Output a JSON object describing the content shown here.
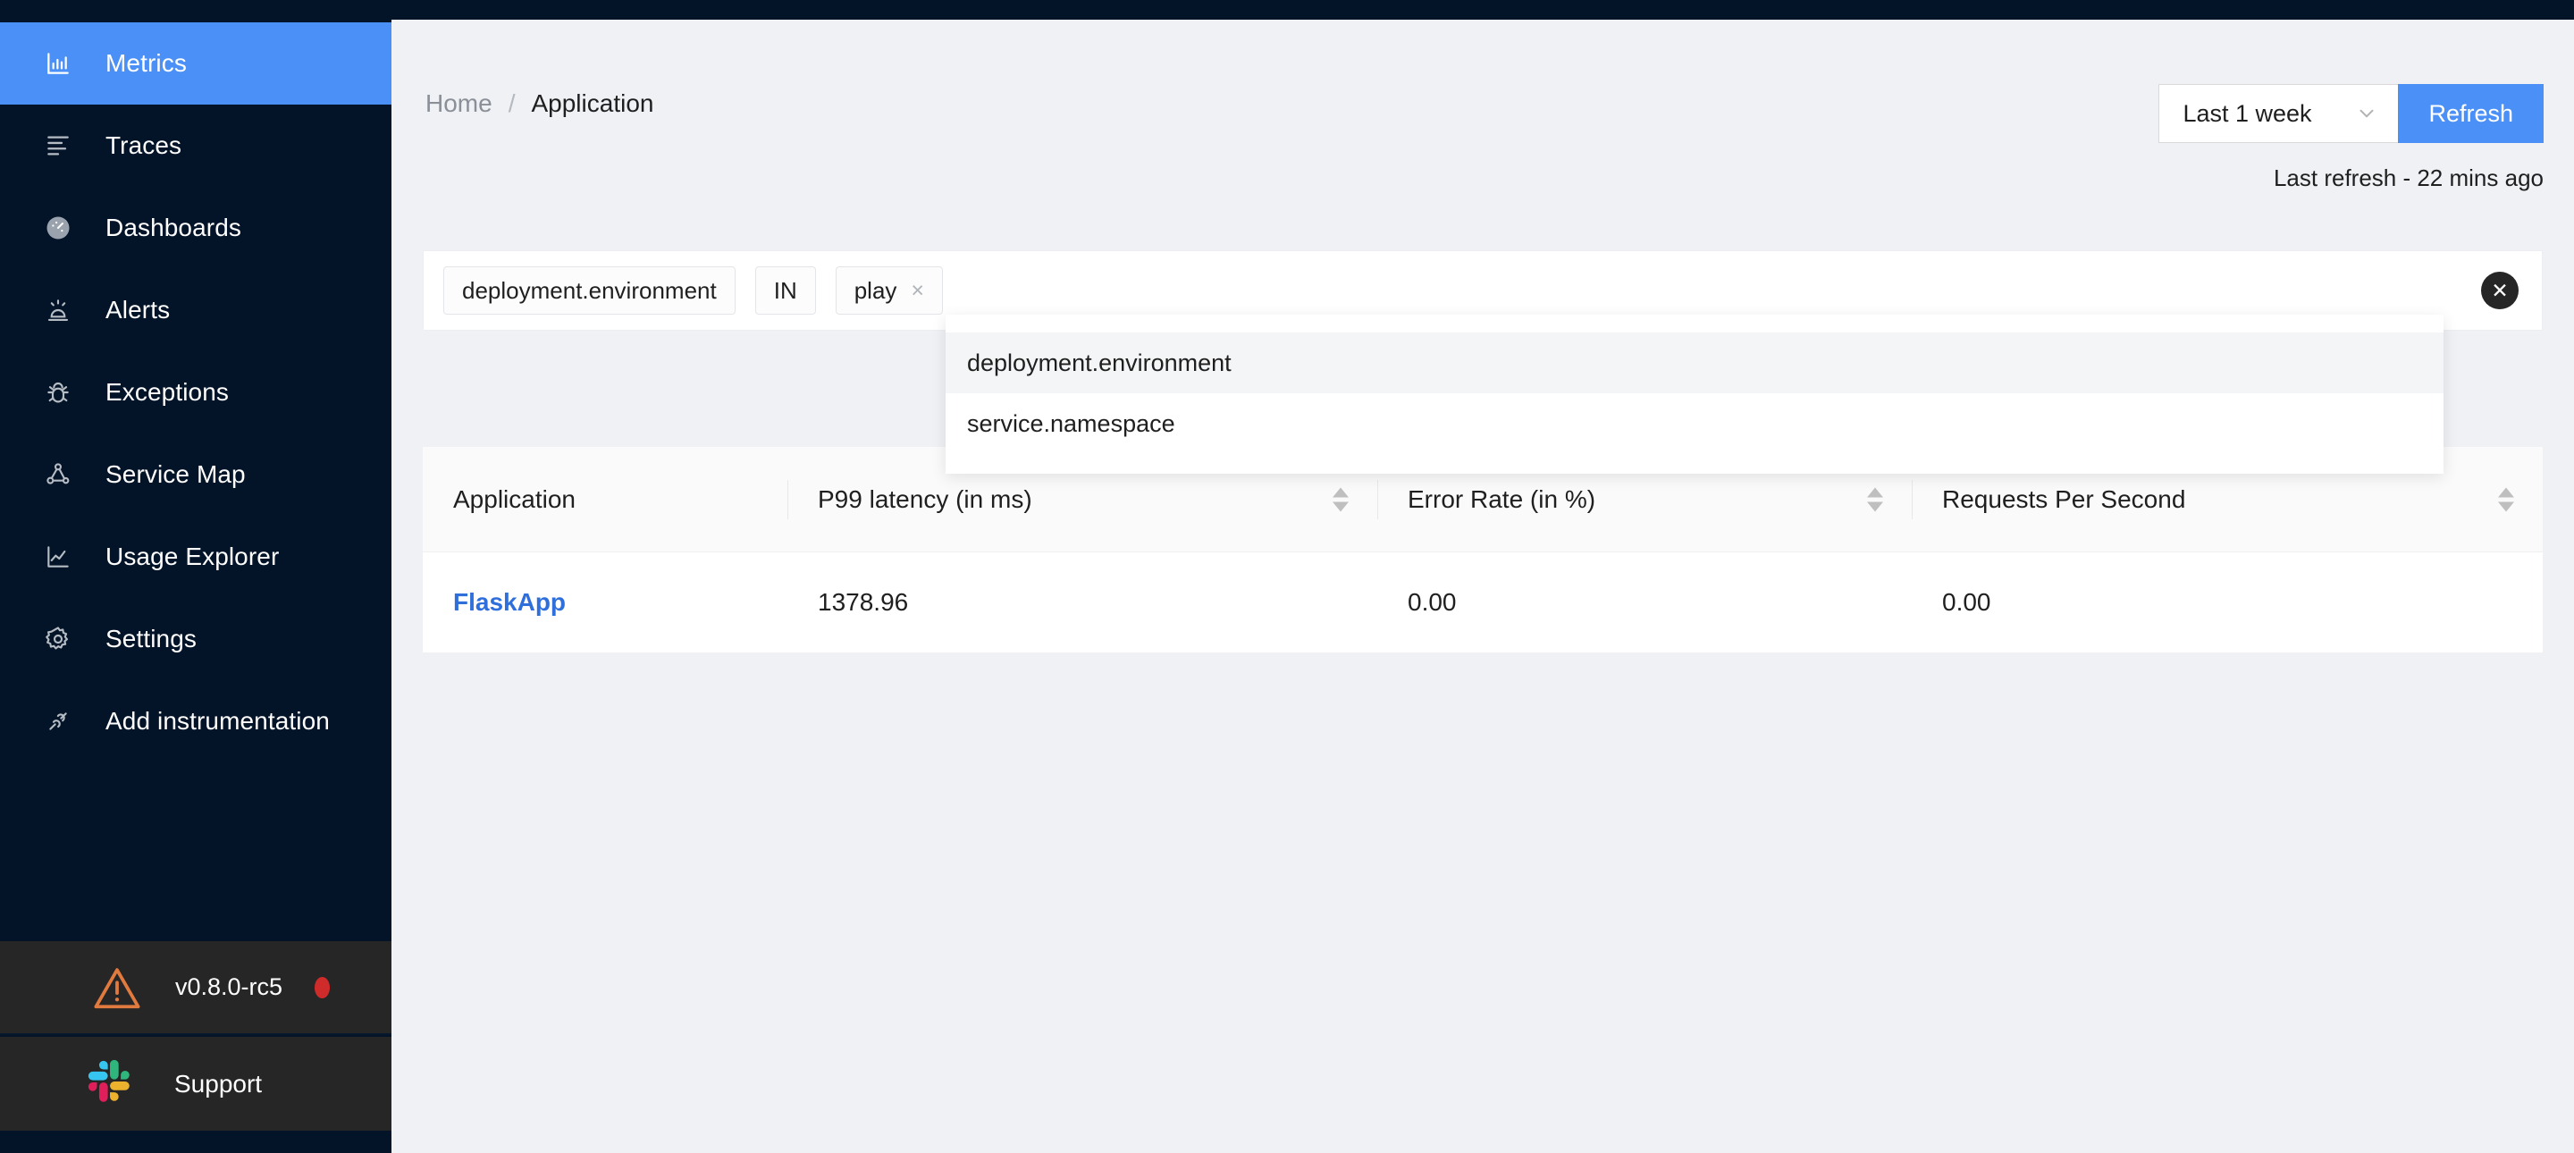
{
  "theme": {
    "sidebar_bg": "#031328",
    "accent": "#4b90f7",
    "footer_bg": "#262626",
    "page_bg": "#eff1f5",
    "link": "#2f6fdc",
    "warn": "#e07a3f",
    "badge_red": "#cf2b2b"
  },
  "sidebar": {
    "items": [
      {
        "label": "Metrics",
        "icon": "bar-chart-icon",
        "active": true
      },
      {
        "label": "Traces",
        "icon": "list-lines-icon",
        "active": false
      },
      {
        "label": "Dashboards",
        "icon": "dashboard-gauge-icon",
        "active": false
      },
      {
        "label": "Alerts",
        "icon": "alarm-light-icon",
        "active": false
      },
      {
        "label": "Exceptions",
        "icon": "bug-icon",
        "active": false
      },
      {
        "label": "Service Map",
        "icon": "node-graph-icon",
        "active": false
      },
      {
        "label": "Usage Explorer",
        "icon": "line-chart-icon",
        "active": false
      },
      {
        "label": "Settings",
        "icon": "gear-icon",
        "active": false
      },
      {
        "label": "Add instrumentation",
        "icon": "plug-connect-icon",
        "active": false
      }
    ],
    "footer": {
      "version": "v0.8.0-rc5",
      "version_icon": "warning-triangle-icon",
      "version_badge": "update-available-dot",
      "support": "Support",
      "support_icon": "slack-icon"
    }
  },
  "header": {
    "breadcrumb": {
      "home": "Home",
      "separator": "/",
      "current": "Application"
    },
    "time_range": {
      "value": "Last 1 week",
      "chevron": "chevron-down-icon"
    },
    "refresh_label": "Refresh",
    "last_refresh": "Last refresh - 22 mins ago"
  },
  "filter_bar": {
    "chips": [
      {
        "text": "deployment.environment",
        "removable": false
      },
      {
        "text": "IN",
        "removable": false
      },
      {
        "text": "play",
        "removable": true,
        "remove_glyph": "×"
      }
    ],
    "clear_all_icon": "close-circle-icon",
    "clear_all_glyph": "✕",
    "placeholder": ""
  },
  "suggestions": {
    "items": [
      {
        "label": "deployment.environment",
        "highlighted": true
      },
      {
        "label": "service.namespace",
        "highlighted": false
      }
    ]
  },
  "table": {
    "columns": [
      {
        "label": "Application",
        "sortable": false
      },
      {
        "label": "P99 latency (in ms)",
        "sortable": true
      },
      {
        "label": "Error Rate (in %)",
        "sortable": true
      },
      {
        "label": "Requests Per Second",
        "sortable": true
      }
    ],
    "rows": [
      {
        "application": "FlaskApp",
        "p99_latency": "1378.96",
        "error_rate": "0.00",
        "requests_per_second": "0.00"
      }
    ]
  }
}
